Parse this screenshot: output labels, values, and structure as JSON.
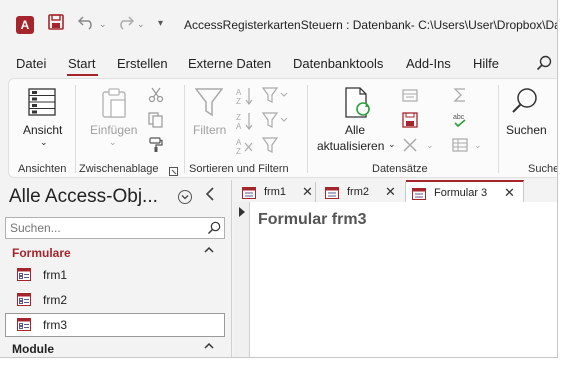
{
  "titlebar": {
    "logo_letter": "A",
    "window_title": "AccessRegisterkartenSteuern : Datenbank- C:\\Users\\User\\Dropbox\\Date"
  },
  "menu": {
    "tabs": [
      "Datei",
      "Start",
      "Erstellen",
      "Externe Daten",
      "Datenbanktools",
      "Add-Ins",
      "Hilfe"
    ],
    "active": "Start"
  },
  "ribbon": {
    "ansicht": {
      "label": "Ansicht",
      "group": "Ansichten"
    },
    "zwischenablage": {
      "paste_label": "Einfügen",
      "group": "Zwischenablage"
    },
    "sortieren": {
      "filter_label": "Filtern",
      "group": "Sortieren und Filtern"
    },
    "datensaetze": {
      "refresh_label_1": "Alle",
      "refresh_label_2": "aktualisieren",
      "group": "Datensätze"
    },
    "suchen": {
      "label": "Suchen",
      "group": "Suche"
    }
  },
  "navpane": {
    "title": "Alle Access-Obj...",
    "search_placeholder": "Suchen...",
    "sections": [
      {
        "label": "Formulare",
        "chevron": "^",
        "items": [
          "frm1",
          "frm2",
          "frm3"
        ],
        "selected": "frm3"
      },
      {
        "label": "Module",
        "chevron": "^"
      }
    ]
  },
  "doc_tabs": [
    {
      "label": "frm1",
      "close": "✕"
    },
    {
      "label": "frm2",
      "close": "✕"
    },
    {
      "label": "Formular 3",
      "close": "✕",
      "active": true
    }
  ],
  "form": {
    "heading": "Formular frm3"
  },
  "colors": {
    "accent": "#a4262c"
  }
}
